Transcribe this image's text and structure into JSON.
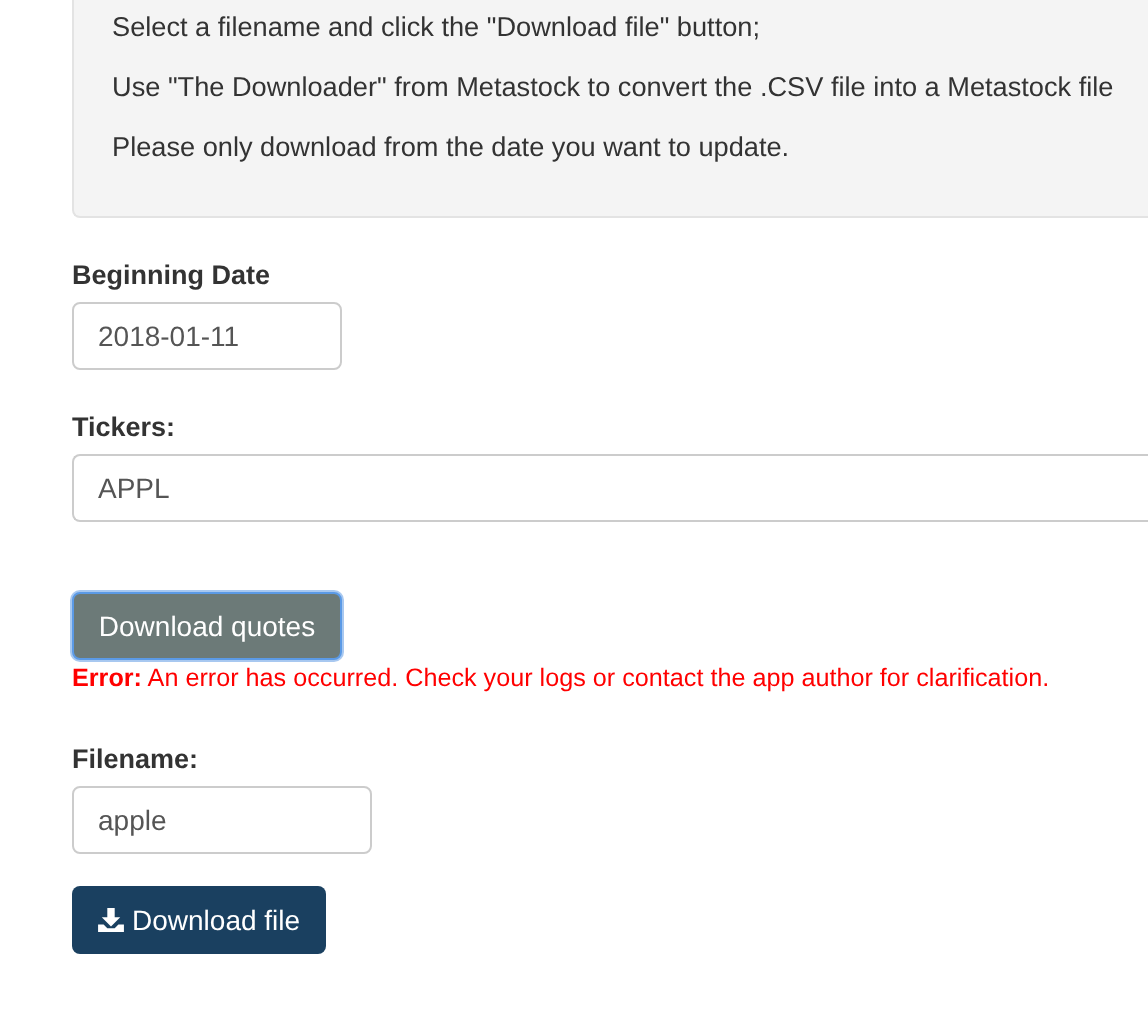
{
  "instructions": [
    "Select a filename and click the \"Download file\" button;",
    "Use \"The Downloader\" from Metastock to convert the .CSV file into a Metastock file",
    "Please only download from the date you want to update."
  ],
  "beginning_date": {
    "label": "Beginning Date",
    "value": "2018-01-11"
  },
  "tickers": {
    "label": "Tickers:",
    "value": "APPL"
  },
  "download_quotes_button": {
    "label": "Download quotes",
    "focused": true
  },
  "error_message": "**Error:** An error has occurred. Check your logs or contact the app author for clarification.",
  "filename": {
    "label": "Filename:",
    "value": "apple"
  },
  "download_file_button": {
    "label": "Download file"
  }
}
